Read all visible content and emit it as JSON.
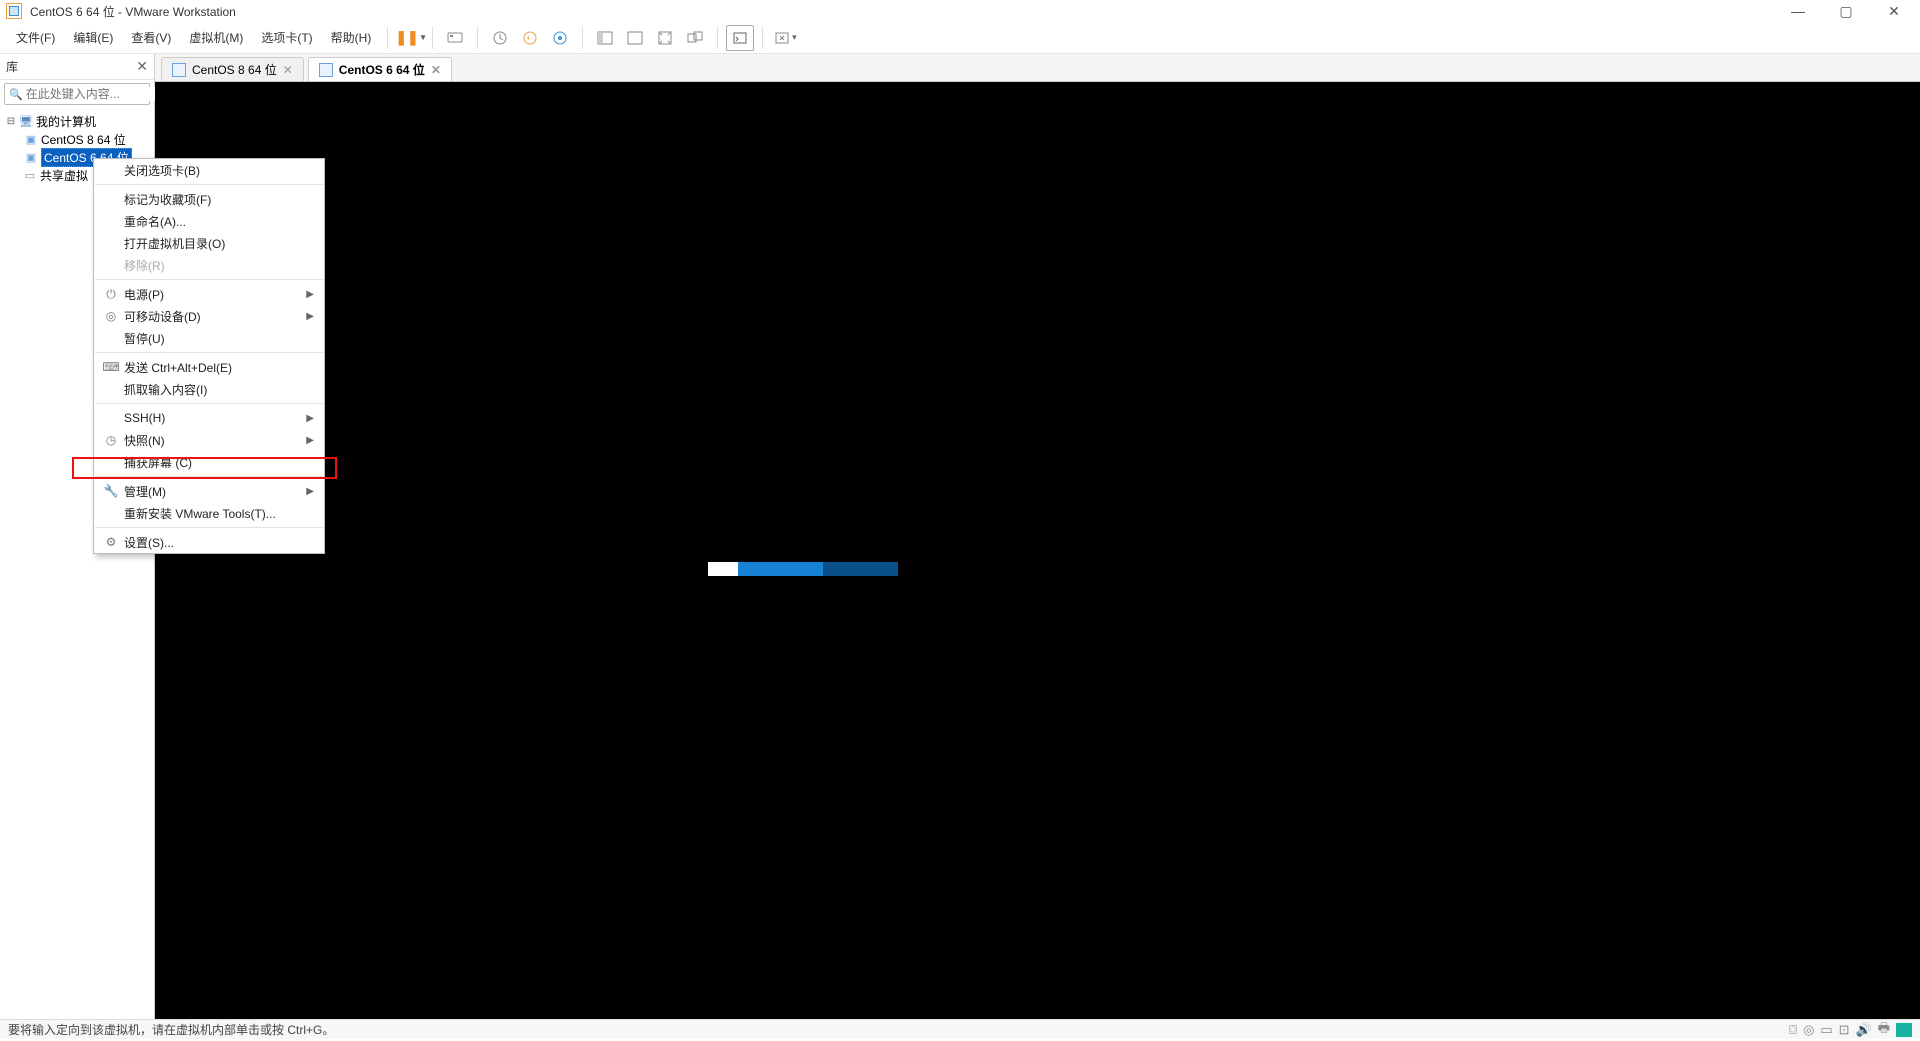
{
  "title": "CentOS 6 64 位 - VMware Workstation",
  "menus": {
    "file": "文件(F)",
    "edit": "编辑(E)",
    "view": "查看(V)",
    "vm": "虚拟机(M)",
    "tabs": "选项卡(T)",
    "help": "帮助(H)"
  },
  "sidebar": {
    "title": "库",
    "search_placeholder": "在此处键入内容...",
    "root": "我的计算机",
    "vm1": "CentOS 8 64 位",
    "vm2": "CentOS 6 64 位",
    "shared": "共享虚拟"
  },
  "tabs": {
    "t1": "CentOS 8 64 位",
    "t2": "CentOS 6 64 位"
  },
  "context": {
    "close_tab": "关闭选项卡(B)",
    "mark_fav": "标记为收藏项(F)",
    "rename": "重命名(A)...",
    "open_dir": "打开虚拟机目录(O)",
    "remove": "移除(R)",
    "power": "电源(P)",
    "removable": "可移动设备(D)",
    "pause": "暂停(U)",
    "send_cad": "发送 Ctrl+Alt+Del(E)",
    "grab_input": "抓取输入内容(I)",
    "ssh": "SSH(H)",
    "snapshot": "快照(N)",
    "capture": "捕获屏幕 (C)",
    "manage": "管理(M)",
    "reinstall_tools": "重新安装 VMware Tools(T)...",
    "settings": "设置(S)..."
  },
  "statusbar": {
    "text": "要将输入定向到该虚拟机，请在虚拟机内部单击或按 Ctrl+G。"
  }
}
